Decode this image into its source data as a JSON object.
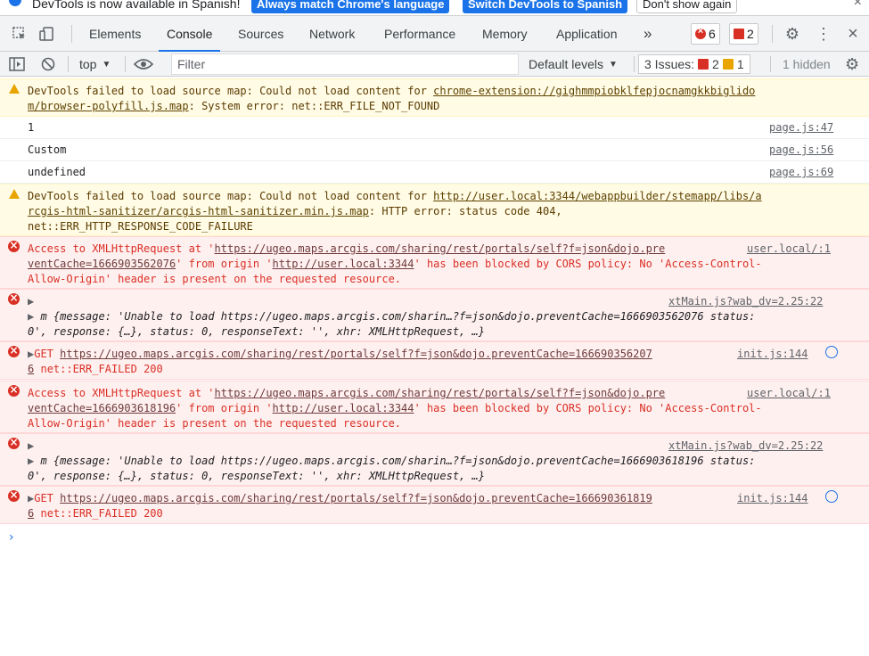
{
  "infobar": {
    "message": "DevTools is now available in Spanish!",
    "btn_match": "Always match Chrome's language",
    "btn_switch": "Switch DevTools to Spanish",
    "btn_dont": "Don't show again"
  },
  "tabs": [
    "Elements",
    "Console",
    "Sources",
    "Network",
    "Performance",
    "Memory",
    "Application"
  ],
  "tabs_more": "»",
  "counts": {
    "errors": "6",
    "issues_flag": "2"
  },
  "filterbar": {
    "context": "top",
    "filter_placeholder": "Filter",
    "levels": "Default levels",
    "issues_label": "3 Issues:",
    "issues_err": "2",
    "issues_warn": "1",
    "hidden": "1 hidden"
  },
  "messages": [
    {
      "level": "warning",
      "lines": [
        "DevTools failed to load source map: Could not load content for ",
        "chrome-extension://gighmmpiobklfepjocnamgkkbiglido",
        "m/browser-polyfill.js.map",
        ": System error: net::ERR_FILE_NOT_FOUND"
      ]
    },
    {
      "level": "log",
      "text": "1",
      "source": "page.js:47"
    },
    {
      "level": "log",
      "text": "Custom",
      "source": "page.js:56"
    },
    {
      "level": "log",
      "text": "undefined",
      "source": "page.js:69"
    },
    {
      "level": "warning",
      "lines": [
        "DevTools failed to load source map: Could not load content for ",
        "http://user.local:3344/webappbuilder/stemapp/libs/a",
        "rcgis-html-sanitizer/arcgis-html-sanitizer.min.js.map",
        ": HTTP error: status code 404,",
        "net::ERR_HTTP_RESPONSE_CODE_FAILURE"
      ]
    },
    {
      "level": "error",
      "parts": [
        "Access to XMLHttpRequest at '",
        "https://ugeo.maps.arcgis.com/sharing/rest/portals/self?f=json&dojo.pre",
        "ventCache=1666903562076",
        "' from origin '",
        "http://user.local:3344",
        "' has been blocked by CORS policy: No 'Access-Control-",
        "Allow-Origin' header is present on the requested resource."
      ],
      "source": "user.local/:1"
    },
    {
      "level": "error",
      "caret": "▶",
      "source": "xtMain.js?wab_dv=2.25:22",
      "object_line1": "{message: 'Unable to load https://ugeo.maps.arcgis.com/sharin…?f=json&dojo.preventCache=1666903562076 status:",
      "object_line2": "0', response: {…}, status: 0, responseText: '', xhr: XMLHttpRequest, …}",
      "object_prefix": "m"
    },
    {
      "level": "error",
      "method": "GET",
      "url1": "https://ugeo.maps.arcgis.com/sharing/rest/portals/self?f=json&dojo.preventCache=166690356207",
      "url2": "6",
      "status": "net::ERR_FAILED 200",
      "source": "init.js:144"
    },
    {
      "level": "error",
      "parts": [
        "Access to XMLHttpRequest at '",
        "https://ugeo.maps.arcgis.com/sharing/rest/portals/self?f=json&dojo.pre",
        "ventCache=1666903618196",
        "' from origin '",
        "http://user.local:3344",
        "' has been blocked by CORS policy: No 'Access-Control-",
        "Allow-Origin' header is present on the requested resource."
      ],
      "source": "user.local/:1"
    },
    {
      "level": "error",
      "caret": "▶",
      "source": "xtMain.js?wab_dv=2.25:22",
      "object_line1": "{message: 'Unable to load https://ugeo.maps.arcgis.com/sharin…?f=json&dojo.preventCache=1666903618196 status:",
      "object_line2": "0', response: {…}, status: 0, responseText: '', xhr: XMLHttpRequest, …}",
      "object_prefix": "m"
    },
    {
      "level": "error",
      "method": "GET",
      "url1": "https://ugeo.maps.arcgis.com/sharing/rest/portals/self?f=json&dojo.preventCache=166690361819",
      "url2": "6",
      "status": "net::ERR_FAILED 200",
      "source": "init.js:144"
    }
  ],
  "prompt": "›"
}
